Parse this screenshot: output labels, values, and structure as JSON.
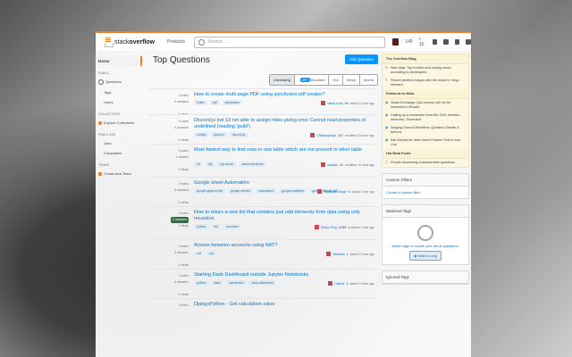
{
  "topbar": {
    "logo_a": "stack",
    "logo_b": "overflow",
    "products": "Products",
    "search_placeholder": "Search...",
    "rep": "145",
    "badge": "• 10"
  },
  "leftnav": {
    "home": "Home",
    "public": "PUBLIC",
    "questions": "Questions",
    "tags": "Tags",
    "users": "Users",
    "collectives": "COLLECTIVES",
    "explore": "Explore Collectives",
    "find_job": "FIND A JOB",
    "jobs": "Jobs",
    "companies": "Companies",
    "teams": "TEAMS",
    "create_team": "Create free Team"
  },
  "main": {
    "title": "Top Questions",
    "ask": "Ask Question",
    "filters": [
      "Interesting",
      "Bountied",
      "Hot",
      "Week",
      "Month"
    ],
    "bountied_count": "297"
  },
  "questions": [
    {
      "votes": "0 votes",
      "answers": "0 answers",
      "views": "2 views",
      "answered": false,
      "title": "How to create multi page PDF using syncfusion pdf creator?",
      "tags": [
        "flutter",
        "pdf",
        "syncfusion"
      ],
      "user": "Vamit-code",
      "rep": "92",
      "when": "asked 15 sec ago"
    },
    {
      "votes": "0 votes",
      "answers": "0 answers",
      "views": "3 views",
      "answered": false,
      "title": "Discord.js bot 13 not able to assign roles giving error Cannot read properties of undefined (reading 'guild')",
      "tags": [
        "nodejs",
        "discord",
        "discord.js"
      ],
      "user": "CDBeingNinja",
      "rep": "317",
      "when": "modified 13 secs ago"
    },
    {
      "votes": "0 votes",
      "answers": "1 answer",
      "views": "3 views",
      "answered": false,
      "title": "Most fastest way to find rows in one table which are not present in other table",
      "tags": [
        "c#",
        "sql",
        "sql-server",
        "azure-functions"
      ],
      "user": "marsalo",
      "rep": "11",
      "when": "modified 19 secs ago"
    },
    {
      "votes": "0 votes",
      "answers": "0 answers",
      "views": "3 views",
      "answered": false,
      "title": "Google sheet Automation",
      "tags": [
        "google-apps-script",
        "google-sheets",
        "automation",
        "google-analytics",
        "google-sheets-api"
      ],
      "user": "Raminder Singh",
      "rep": "9",
      "when": "asked 1 min ago"
    },
    {
      "votes": "0 votes",
      "answers": "2 answers",
      "views": "7 views",
      "answered": true,
      "title": "How to return a new list that contains just odd elements from data using only recursion",
      "tags": [
        "python",
        "list",
        "recursion"
      ],
      "user": "Arthur King",
      "rep": "4,040",
      "when": "modified 1 min ago"
    },
    {
      "votes": "0 votes",
      "answers": "0 answers",
      "views": "3 views",
      "answered": false,
      "title": "Access between accounts using NAT?",
      "tags": [
        "nat",
        "vpc"
      ],
      "user": "Venessa",
      "rep": "1",
      "when": "asked 2 mins ago"
    },
    {
      "votes": "0 votes",
      "answers": "0 answers",
      "views": "2 views",
      "answered": false,
      "title": "Starting Dask Dashboard outside Jupyter Notebooks",
      "tags": [
        "python",
        "dask",
        "dashboard",
        "dask-distributed"
      ],
      "user": "Hakner",
      "rep": "1",
      "when": "asked 2 mins ago"
    },
    {
      "votes": "0 votes",
      "answers": "",
      "views": "",
      "answered": false,
      "title": "DjangoPython - Get calculation value",
      "tags": [],
      "user": "",
      "rep": "",
      "when": ""
    }
  ],
  "sidebar": {
    "blog_title": "The Overflow Blog",
    "blog_items": [
      "New data: Top movies and coding music according to developers",
      "Picture perfect images with the modern <img> element"
    ],
    "meta_title": "Featured on Meta",
    "meta_items": [
      "Stack Exchange Q&A access will not be restricted in Russia",
      "Calling up a moderator from the 2021 election - welcome, Shermani!",
      "Staging Ground Workflow: Question Details & Actions",
      "Ask Wizard for New Users Feature Test is now Live"
    ],
    "hot_title": "Hot Meta Posts",
    "hot_items": [
      "People answering unanswerable questions"
    ],
    "custom_title": "Custom Filters",
    "custom_link": "Create a custom filter",
    "watched_title": "Watched Tags",
    "watched_text": "Watch tags to curate your list of questions.",
    "watched_btn": "Watch a tag",
    "ignored_title": "Ignored Tags"
  }
}
